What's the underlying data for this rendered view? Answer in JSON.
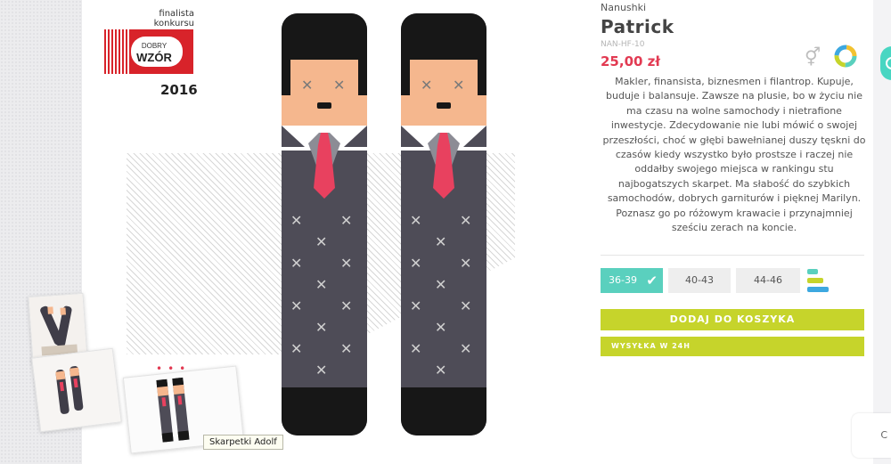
{
  "award": {
    "small_text_line1": "finalista",
    "small_text_line2": "konkursu",
    "logo_line1": "DOBRY",
    "logo_line2": "WZÓR",
    "year": "2016"
  },
  "product": {
    "brand": "Nanushki",
    "name": "Patrick",
    "sku": "NAN-HF-10",
    "price": "25,00 zł",
    "description": "Makler, finansista, biznesmen i filantrop. Kupuje, buduje i balansuje. Zawsze na plusie, bo w życiu nie ma czasu na wolne samochody i nietrafione inwestycje. Zdecydowanie nie lubi mówić o swojej przeszłości, choć w głębi bawełnianej duszy tęskni do czasów kiedy wszystko było prostsze i raczej nie oddałby swojego miejsca w rankingu stu najbogatszych skarpet. Ma słabość do szybkich samochodów, dobrych garniturów i pięknej Marilyn. Poznasz go po różowym krawacie i przynajmniej sześciu zerach na koncie."
  },
  "sizes": [
    {
      "label": "36-39",
      "selected": true
    },
    {
      "label": "40-43",
      "selected": false
    },
    {
      "label": "44-46",
      "selected": false
    }
  ],
  "actions": {
    "add_to_cart": "DODAJ DO KOSZYKA",
    "shipping": "WYSYŁKA W 24H"
  },
  "tooltip": "Skarpetki Adolf",
  "side_tab_letter": "C",
  "icons": {
    "gender": "gender-neutral-icon",
    "ring": "multicolor-ring-icon",
    "size_chart": "size-chart-icon",
    "check": "check-icon"
  },
  "colors": {
    "accent_purple": "#9b6bcf",
    "price_red": "#e23a52",
    "teal": "#5ad0be",
    "lime": "#c6d42b"
  }
}
